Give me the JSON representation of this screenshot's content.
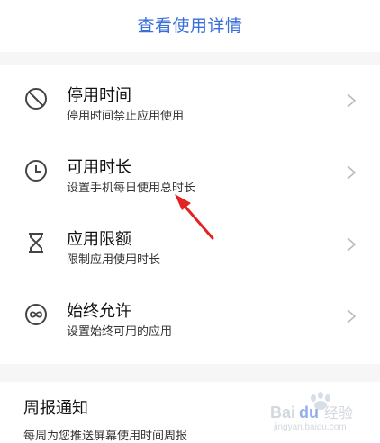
{
  "header": {
    "view_details_link": "查看使用详情"
  },
  "settings": [
    {
      "title": "停用时间",
      "subtitle": "停用时间禁止应用使用",
      "icon": "block-icon"
    },
    {
      "title": "可用时长",
      "subtitle": "设置手机每日使用总时长",
      "icon": "clock-icon"
    },
    {
      "title": "应用限额",
      "subtitle": "限制应用使用时长",
      "icon": "hourglass-icon"
    },
    {
      "title": "始终允许",
      "subtitle": "设置始终可用的应用",
      "icon": "infinity-icon"
    }
  ],
  "weekly_report": {
    "title": "周报通知",
    "subtitle": "每周为您推送屏幕使用时间周报"
  },
  "watermark": {
    "text": "Bai 经验"
  },
  "colors": {
    "link_blue": "#3a6fd8",
    "annotation_red": "#e32222",
    "divider_gray": "#f6f6f6"
  }
}
